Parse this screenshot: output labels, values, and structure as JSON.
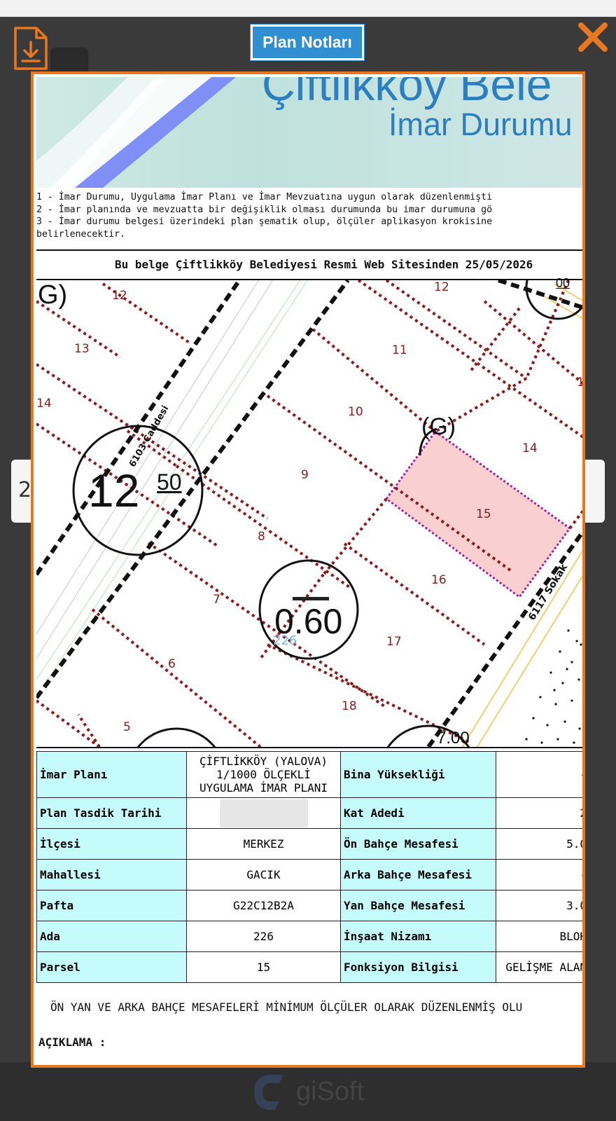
{
  "header": {
    "title": "Plan Notları"
  },
  "document": {
    "logo_title": "Çiftlikköy Bele",
    "logo_subtitle": "İmar Durumu",
    "notes": [
      "1 - İmar Durumu, Uygulama İmar Planı ve İmar Mevzuatına uygun olarak düzenlenmişti",
      "2 - İmar planında ve mevzuatta bir değişiklik olması durumunda bu imar durumuna gö",
      "3 - İmar durumu belgesi üzerindeki plan şematik olup, ölçüler aplikasyon krokisine",
      "belirlenecektir."
    ],
    "source_line": "Bu belge Çiftlikköy Belediyesi Resmi Web Sitesinden 25/05/2026",
    "footnote": "ÖN YAN VE ARKA BAHÇE MESAFELERİ MİNİMUM ÖLÇÜLER OLARAK DÜZENLENMİŞ OLU",
    "aciklama_label": "AÇIKLAMA :"
  },
  "map": {
    "parcel_numbers": [
      "12",
      "13",
      "14",
      "11",
      "10",
      "9",
      "8",
      "7",
      "6",
      "5",
      "15",
      "16",
      "17",
      "18",
      "12",
      "14",
      "1"
    ],
    "zone_label": "(G)",
    "corner_label": "G)",
    "height_main": "12",
    "height_main_sup": "50",
    "density_label": "0.60",
    "block_number": "226",
    "road_label_1": "6103 Caddesi",
    "road_label_2": "6117 Sokak",
    "corner_height": "7.00",
    "top_right_height": "00",
    "highlight_color": "#f9cfd0"
  },
  "info_table": [
    {
      "l1": "İmar Planı",
      "v1": "ÇİFTLİKKÖY (YALOVA) 1/1000 ÖLÇEKLİ UYGULAMA İMAR PLANI",
      "l2": "Bina Yüksekliği",
      "v2": "-"
    },
    {
      "l1": "Plan Tasdik Tarihi",
      "v1": "",
      "l2": "Kat Adedi",
      "v2": "2"
    },
    {
      "l1": "İlçesi",
      "v1": "MERKEZ",
      "l2": "Ön Bahçe Mesafesi",
      "v2": "5.0"
    },
    {
      "l1": "Mahallesi",
      "v1": "GACIK",
      "l2": "Arka Bahçe Mesafesi",
      "v2": "-"
    },
    {
      "l1": "Pafta",
      "v1": "G22C12B2A",
      "l2": "Yan Bahçe Mesafesi",
      "v2": "3.0"
    },
    {
      "l1": "Ada",
      "v1": "226",
      "l2": "İnşaat Nizamı",
      "v2": "BLOK"
    },
    {
      "l1": "Parsel",
      "v1": "15",
      "l2": "Fonksiyon Bilgisi",
      "v2": "GELİŞME ALAN"
    }
  ],
  "background": {
    "card_left": "2",
    "watermark": "giSoft"
  }
}
